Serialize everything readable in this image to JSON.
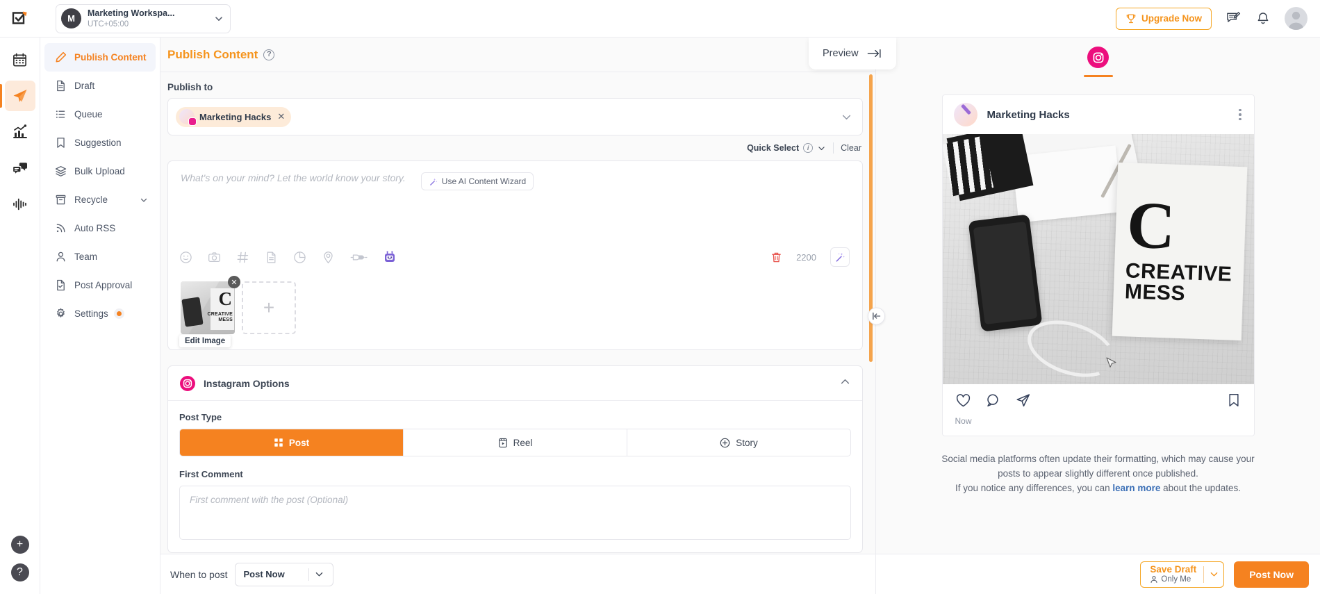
{
  "topbar": {
    "logo_icon": "contentstudio-logo-icon",
    "workspace": {
      "avatar_initial": "M",
      "name": "Marketing Workspa...",
      "timezone": "UTC+05:00",
      "chevron_icon": "chevron-down-icon"
    },
    "upgrade_label": "Upgrade Now",
    "upgrade_icon": "trophy-icon",
    "feedback_icon": "feedback-icon",
    "notifications_icon": "bell-icon",
    "profile_icon": "avatar"
  },
  "rail": {
    "items": [
      {
        "icon": "calendar-icon",
        "name": "calendar",
        "active": false
      },
      {
        "icon": "paper-plane-icon",
        "name": "publish",
        "active": true
      },
      {
        "icon": "analytics-icon",
        "name": "analytics",
        "active": false
      },
      {
        "icon": "inbox-chat-icon",
        "name": "inbox",
        "active": false
      },
      {
        "icon": "audio-wave-icon",
        "name": "listening",
        "active": false
      }
    ],
    "add_label": "+",
    "help_label": "?"
  },
  "sidebar": {
    "items": [
      {
        "label": "Publish Content",
        "icon": "pencil-icon",
        "active": true,
        "chevron": false,
        "dot": false
      },
      {
        "label": "Draft",
        "icon": "document-icon",
        "active": false,
        "chevron": false,
        "dot": false
      },
      {
        "label": "Queue",
        "icon": "list-icon",
        "active": false,
        "chevron": false,
        "dot": false
      },
      {
        "label": "Suggestion",
        "icon": "bookmark-icon",
        "active": false,
        "chevron": false,
        "dot": false
      },
      {
        "label": "Bulk Upload",
        "icon": "layers-icon",
        "active": false,
        "chevron": false,
        "dot": false
      },
      {
        "label": "Recycle",
        "icon": "archive-icon",
        "active": false,
        "chevron": true,
        "dot": false
      },
      {
        "label": "Auto RSS",
        "icon": "rss-icon",
        "active": false,
        "chevron": false,
        "dot": false
      },
      {
        "label": "Team",
        "icon": "user-icon",
        "active": false,
        "chevron": false,
        "dot": false
      },
      {
        "label": "Post Approval",
        "icon": "document-check-icon",
        "active": false,
        "chevron": false,
        "dot": false
      },
      {
        "label": "Settings",
        "icon": "gear-icon",
        "active": false,
        "chevron": true,
        "dot": true
      }
    ]
  },
  "main": {
    "page_title": "Publish Content",
    "help_icon": "question-mark-icon",
    "publish_to_label": "Publish to",
    "selected_account": {
      "name": "Marketing Hacks",
      "platform_icon": "instagram-badge-icon",
      "remove_icon": "close-icon"
    },
    "publish_to_chevron": "chevron-down-icon",
    "quick_select_label": "Quick Select",
    "quick_select_info_icon": "info-icon",
    "quick_select_chevron": "chevron-down-icon",
    "clear_label": "Clear",
    "composer": {
      "placeholder": "What's on your mind? Let the world know your story.",
      "ai_wizard_label": "Use AI Content Wizard",
      "ai_wizard_icon": "magic-wand-icon",
      "tools": [
        "emoji-icon",
        "camera-icon",
        "hashtag-icon",
        "document-icon",
        "pie-chart-icon",
        "location-pin-icon",
        "plug-icon",
        "robot-icon"
      ],
      "delete_icon": "trash-icon",
      "char_count": "2200",
      "wand_icon": "magic-wand-icon",
      "media": {
        "edit_image_label": "Edit Image",
        "remove_icon": "close-icon",
        "add_label": "+",
        "image_text_big": "C",
        "image_text_small_1": "CREATIVE",
        "image_text_small_2": "MESS"
      }
    },
    "instagram_options": {
      "title": "Instagram Options",
      "icon": "instagram-icon",
      "collapse_icon": "chevron-up-icon",
      "post_type_label": "Post Type",
      "post_types": [
        {
          "label": "Post",
          "icon": "grid-icon",
          "active": true
        },
        {
          "label": "Reel",
          "icon": "reel-icon",
          "active": false
        },
        {
          "label": "Story",
          "icon": "plus-circle-icon",
          "active": false
        }
      ],
      "first_comment_label": "First Comment",
      "first_comment_placeholder": "First comment with the post (Optional)"
    },
    "bottom": {
      "when_to_post_label": "When to post",
      "when_to_post_value": "Post Now",
      "when_chevron": "chevron-down-icon"
    },
    "collapse_handle_icon": "collapse-left-icon"
  },
  "preview": {
    "preview_label": "Preview",
    "preview_icon": "arrow-right-to-line-icon",
    "platform_tab_icon": "instagram-icon",
    "card": {
      "account_name": "Marketing Hacks",
      "menu_icon": "kebab-menu-icon",
      "image_big_letter": "C",
      "image_line_1": "CREATIVE",
      "image_line_2": "MESS",
      "actions": {
        "like_icon": "heart-icon",
        "comment_icon": "comment-icon",
        "share_icon": "send-icon",
        "save_icon": "bookmark-icon"
      },
      "timestamp": "Now"
    },
    "disclaimer": {
      "line_1": "Social media platforms often update their formatting, which may cause your",
      "line_2": "posts to appear slightly different once published.",
      "line_3_before": "If you notice any differences, you can ",
      "link": "learn more",
      "line_3_after": " about the updates."
    },
    "footer": {
      "save_draft_label": "Save Draft",
      "save_draft_visibility": "Only Me",
      "visibility_icon": "person-icon",
      "save_draft_chevron": "chevron-down-icon",
      "post_now_label": "Post Now"
    }
  },
  "colors": {
    "accent_orange": "#f58220",
    "instagram_pink": "#ec0e7d",
    "link_blue": "#3b6fb6",
    "text_dark": "#2f3a4a",
    "text_muted": "#8e95a3"
  }
}
